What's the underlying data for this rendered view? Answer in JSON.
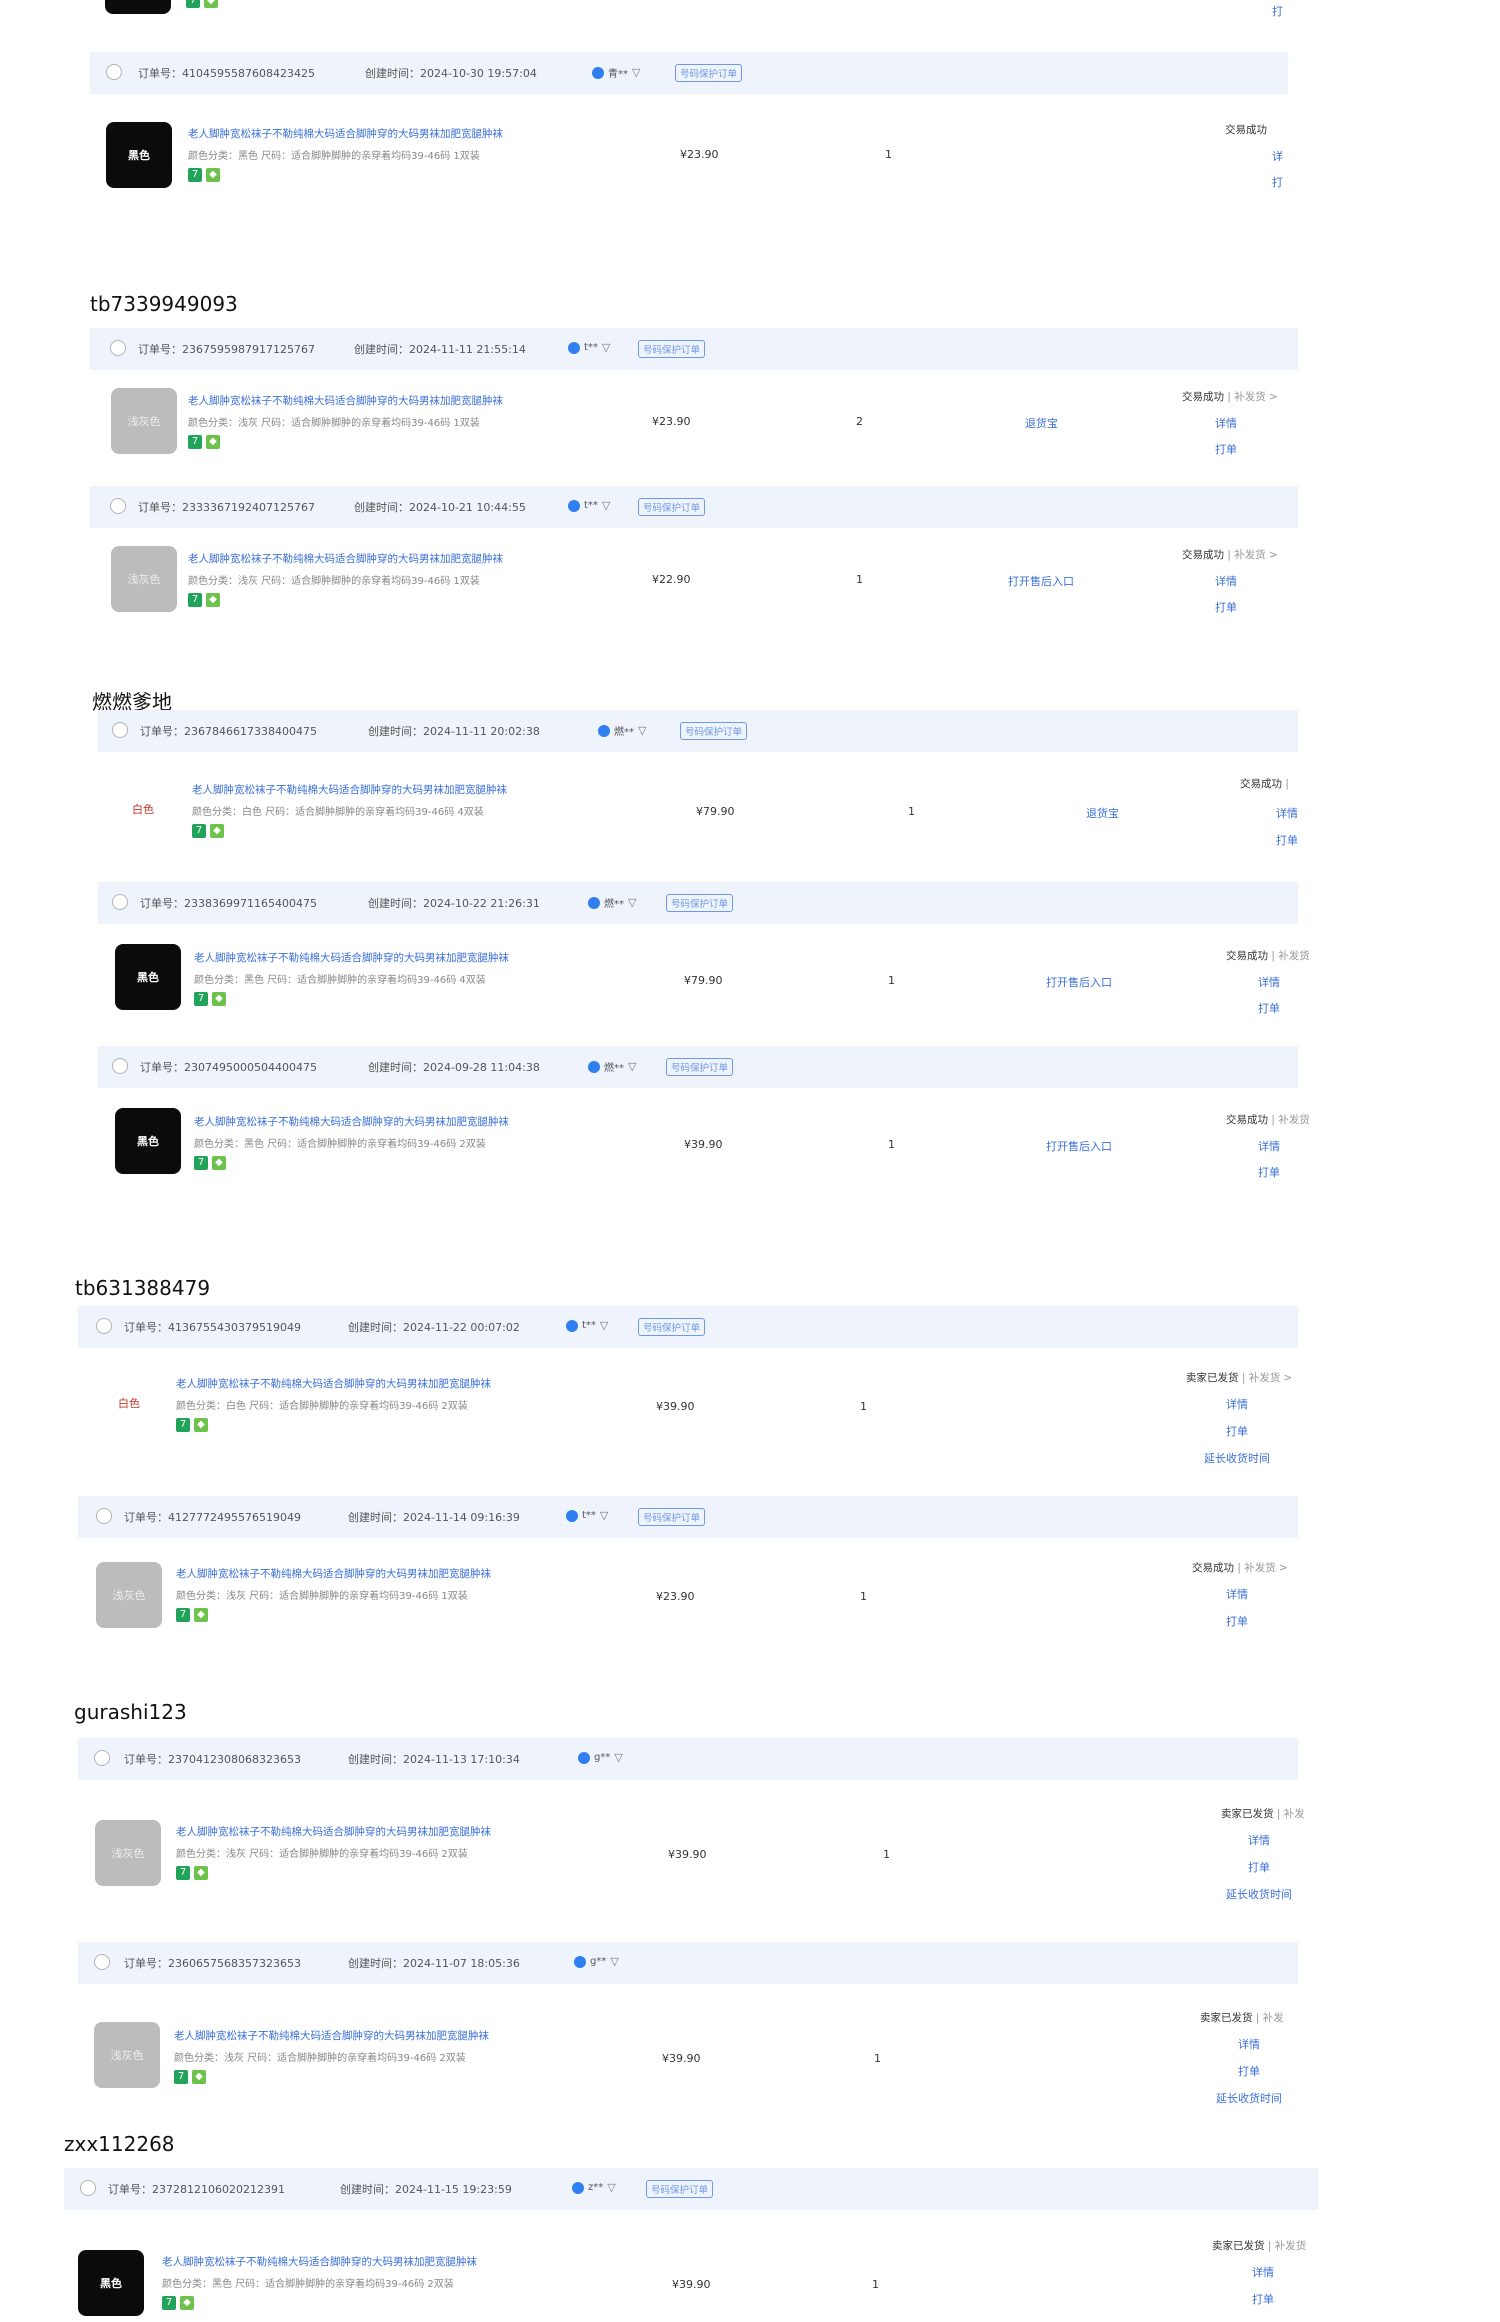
{
  "labels": {
    "order_no": "订单号：",
    "created": "创建时间：",
    "protect_tag": "号码保护订单",
    "detail": "详情",
    "print": "打单",
    "extend": "延长收货时间",
    "product_title": "老人脚肿宽松袜子不勒纯棉大码适合脚肿穿的大码男袜加肥宽腿肿袜"
  },
  "top_partial": {
    "link": "打"
  },
  "groups": [
    {
      "title": "",
      "orders": [
        {
          "order_no": "4104595587608423425",
          "created": "2024-10-30 19:57:04",
          "buyer": "青**",
          "protect": true,
          "img_text": "黑色",
          "img_style": "black",
          "spec": "颜色分类：黑色  尺码：适合脚肿脚肿的亲穿着均码39-46码 1双装",
          "price": "¥23.90",
          "qty": "1",
          "mid_link": "",
          "status": "交易成功",
          "status_sub": "",
          "links": [
            "详",
            "打"
          ]
        }
      ]
    },
    {
      "title": "tb7339949093",
      "orders": [
        {
          "order_no": "2367595987917125767",
          "created": "2024-11-11 21:55:14",
          "buyer": "t**",
          "protect": true,
          "img_text": "浅灰色",
          "img_style": "grey",
          "spec": "颜色分类：浅灰  尺码：适合脚肿脚肿的亲穿着均码39-46码 1双装",
          "price": "¥23.90",
          "qty": "2",
          "mid_link": "退货宝",
          "status": "交易成功",
          "status_sub": " | 补发货 >",
          "links": [
            "详情",
            "打单"
          ]
        },
        {
          "order_no": "2333367192407125767",
          "created": "2024-10-21 10:44:55",
          "buyer": "t**",
          "protect": true,
          "img_text": "浅灰色",
          "img_style": "grey",
          "spec": "颜色分类：浅灰  尺码：适合脚肿脚肿的亲穿着均码39-46码 1双装",
          "price": "¥22.90",
          "qty": "1",
          "mid_link": "打开售后入口",
          "status": "交易成功",
          "status_sub": " | 补发货 >",
          "links": [
            "详情",
            "打单"
          ]
        }
      ]
    },
    {
      "title": "燃燃爹地",
      "orders": [
        {
          "order_no": "2367846617338400475",
          "created": "2024-11-11 20:02:38",
          "buyer": "燃**",
          "protect": true,
          "img_text": "白色",
          "img_style": "white",
          "spec": "颜色分类：白色  尺码：适合脚肿脚肿的亲穿着均码39-46码 4双装",
          "price": "¥79.90",
          "qty": "1",
          "mid_link": "退货宝",
          "status": "交易成功",
          "status_sub": " |",
          "links": [
            "详情",
            "打单"
          ]
        },
        {
          "order_no": "2338369971165400475",
          "created": "2024-10-22 21:26:31",
          "buyer": "燃**",
          "protect": true,
          "img_text": "黑色",
          "img_style": "black",
          "spec": "颜色分类：黑色  尺码：适合脚肿脚肿的亲穿着均码39-46码 4双装",
          "price": "¥79.90",
          "qty": "1",
          "mid_link": "打开售后入口",
          "status": "交易成功",
          "status_sub": " | 补发货",
          "links": [
            "详情",
            "打单"
          ]
        },
        {
          "order_no": "2307495000504400475",
          "created": "2024-09-28 11:04:38",
          "buyer": "燃**",
          "protect": true,
          "img_text": "黑色",
          "img_style": "black",
          "spec": "颜色分类：黑色  尺码：适合脚肿脚肿的亲穿着均码39-46码 2双装",
          "price": "¥39.90",
          "qty": "1",
          "mid_link": "打开售后入口",
          "status": "交易成功",
          "status_sub": " | 补发货",
          "links": [
            "详情",
            "打单"
          ]
        }
      ]
    },
    {
      "title": "tb631388479",
      "orders": [
        {
          "order_no": "4136755430379519049",
          "created": "2024-11-22 00:07:02",
          "buyer": "t**",
          "protect": true,
          "img_text": "白色",
          "img_style": "white",
          "spec": "颜色分类：白色  尺码：适合脚肿脚肿的亲穿着均码39-46码 2双装",
          "price": "¥39.90",
          "qty": "1",
          "mid_link": "",
          "status": "卖家已发货",
          "status_sub": " | 补发货 >",
          "links": [
            "详情",
            "打单",
            "延长收货时间"
          ]
        },
        {
          "order_no": "4127772495576519049",
          "created": "2024-11-14 09:16:39",
          "buyer": "t**",
          "protect": true,
          "img_text": "浅灰色",
          "img_style": "grey",
          "spec": "颜色分类：浅灰  尺码：适合脚肿脚肿的亲穿着均码39-46码 1双装",
          "price": "¥23.90",
          "qty": "1",
          "mid_link": "",
          "status": "交易成功",
          "status_sub": " | 补发货 >",
          "links": [
            "详情",
            "打单"
          ]
        }
      ]
    },
    {
      "title": "gurashi123",
      "orders": [
        {
          "order_no": "2370412308068323653",
          "created": "2024-11-13 17:10:34",
          "buyer": "g**",
          "protect": false,
          "img_text": "浅灰色",
          "img_style": "grey",
          "spec": "颜色分类：浅灰  尺码：适合脚肿脚肿的亲穿着均码39-46码 2双装",
          "price": "¥39.90",
          "qty": "1",
          "mid_link": "",
          "status": "卖家已发货",
          "status_sub": " | 补发",
          "links": [
            "详情",
            "打单",
            "延长收货时间"
          ]
        },
        {
          "order_no": "2360657568357323653",
          "created": "2024-11-07 18:05:36",
          "buyer": "g**",
          "protect": false,
          "img_text": "浅灰色",
          "img_style": "grey",
          "spec": "颜色分类：浅灰  尺码：适合脚肿脚肿的亲穿着均码39-46码 2双装",
          "price": "¥39.90",
          "qty": "1",
          "mid_link": "",
          "status": "卖家已发货",
          "status_sub": " | 补发",
          "links": [
            "详情",
            "打单",
            "延长收货时间"
          ]
        }
      ]
    },
    {
      "title": "zxx112268",
      "orders": [
        {
          "order_no": "2372812106020212391",
          "created": "2024-11-15 19:23:59",
          "buyer": "z**",
          "protect": true,
          "img_text": "黑色",
          "img_style": "black",
          "spec": "颜色分类：黑色  尺码：适合脚肿脚肿的亲穿着均码39-46码 2双装",
          "price": "¥39.90",
          "qty": "1",
          "mid_link": "",
          "status": "卖家已发货",
          "status_sub": " | 补发货",
          "links": [
            "详情",
            "打单"
          ]
        }
      ]
    }
  ]
}
